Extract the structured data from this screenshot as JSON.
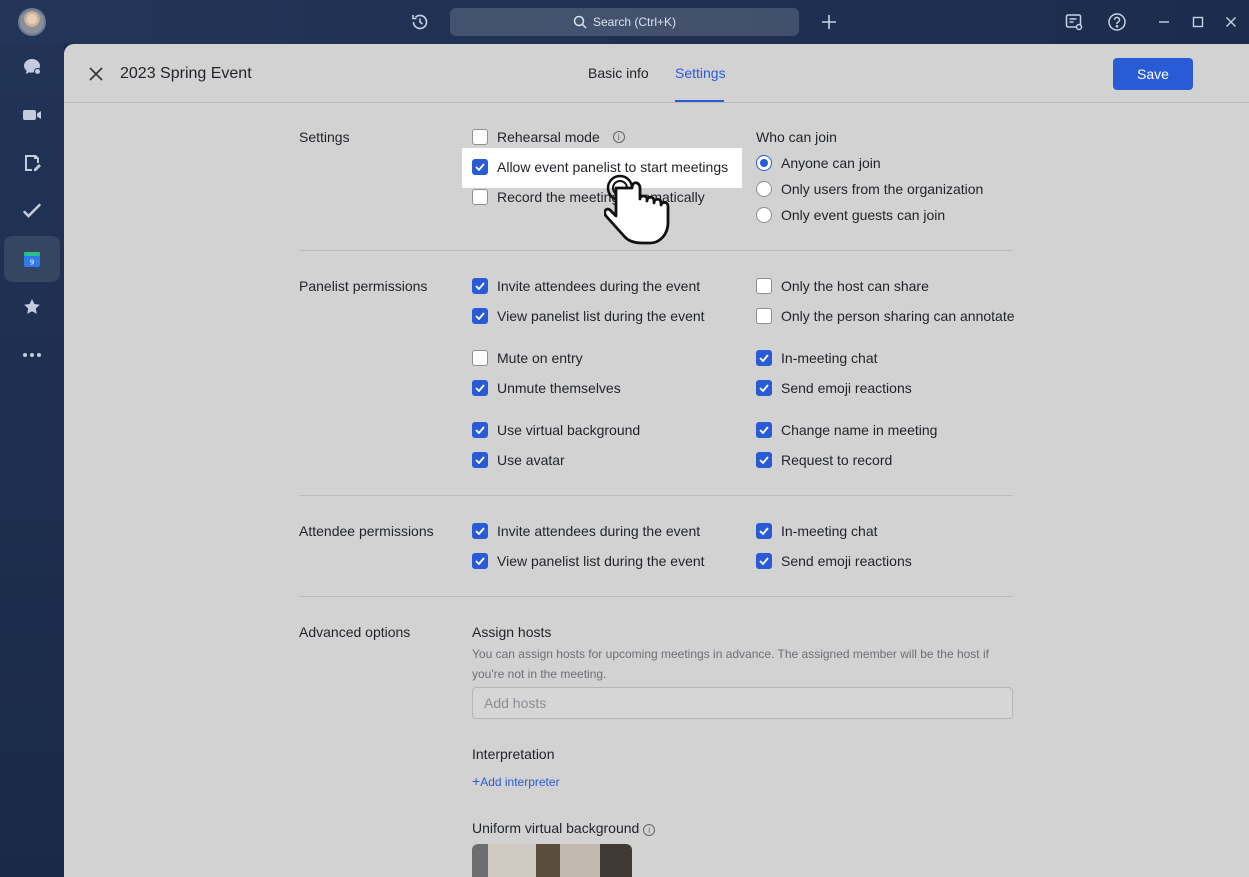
{
  "titlebar": {
    "search_label": "Search (Ctrl+K)"
  },
  "event": {
    "title": "2023 Spring Event",
    "tabs": [
      "Basic info",
      "Settings"
    ],
    "active_tab": "Settings",
    "save_label": "Save"
  },
  "settings": {
    "label": "Settings",
    "options": [
      {
        "label": "Rehearsal mode",
        "checked": false
      },
      {
        "label": "Allow event panelist to start meetings",
        "checked": true
      },
      {
        "label": "Record the meeting automatically",
        "checked": false
      }
    ],
    "who_can_join": {
      "label": "Who can join",
      "options": [
        "Anyone can join",
        "Only users from the organization",
        "Only event guests can join"
      ],
      "selected": "Anyone can join"
    }
  },
  "panelist_permissions": {
    "label": "Panelist permissions",
    "left": [
      {
        "label": "Invite attendees during the event",
        "checked": true
      },
      {
        "label": "View panelist list during the event",
        "checked": true
      },
      {
        "label": "Mute on entry",
        "checked": false
      },
      {
        "label": "Unmute themselves",
        "checked": true
      },
      {
        "label": "Use virtual background",
        "checked": true
      },
      {
        "label": "Use avatar",
        "checked": true
      }
    ],
    "right": [
      {
        "label": "Only the host can share",
        "checked": false
      },
      {
        "label": "Only the person sharing can annotate",
        "checked": false
      },
      {
        "label": "In-meeting chat",
        "checked": true
      },
      {
        "label": "Send emoji reactions",
        "checked": true
      },
      {
        "label": "Change name in meeting",
        "checked": true
      },
      {
        "label": "Request to record",
        "checked": true
      }
    ]
  },
  "attendee_permissions": {
    "label": "Attendee permissions",
    "left": [
      {
        "label": "Invite attendees during the event",
        "checked": true
      },
      {
        "label": "View panelist list during the event",
        "checked": true
      }
    ],
    "right": [
      {
        "label": "In-meeting chat",
        "checked": true
      },
      {
        "label": "Send emoji reactions",
        "checked": true
      }
    ]
  },
  "advanced": {
    "label": "Advanced options",
    "assign_hosts_title": "Assign hosts",
    "assign_hosts_hint": "You can assign hosts for upcoming meetings in advance. The assigned member will be the host if you're not in the meeting.",
    "hosts_placeholder": "Add hosts",
    "interpretation_title": "Interpretation",
    "add_interpreter": "Add interpreter",
    "uniform_bg_title": "Uniform virtual background"
  },
  "colors": {
    "accent": "#2a5bd7",
    "panel_bg": "#d2d2d2",
    "rail_bg": "#1b2a4a"
  }
}
